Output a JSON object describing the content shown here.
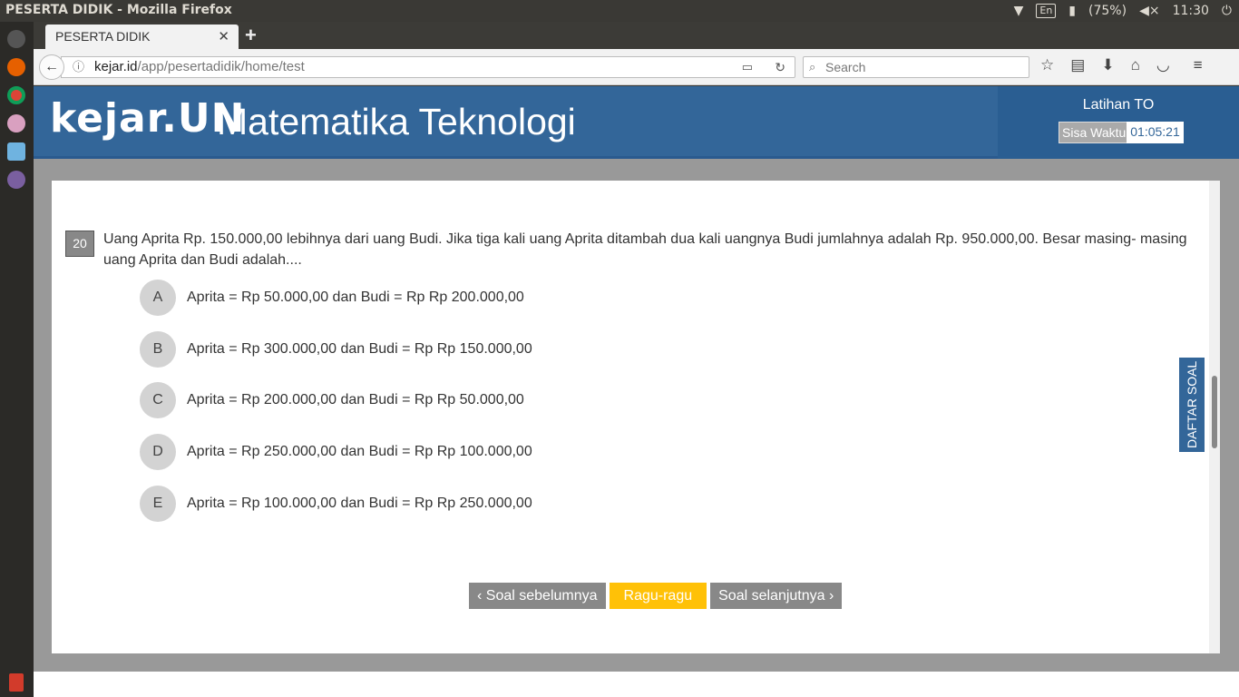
{
  "os": {
    "window_title": "PESERTA DIDIK - Mozilla Firefox",
    "keyboard": "En",
    "battery": "(75%)",
    "clock": "11:30"
  },
  "browser": {
    "tab_title": "PESERTA DIDIK",
    "url_domain": "kejar.id",
    "url_path": "/app/pesertadidik/home/test",
    "search_placeholder": "Search"
  },
  "header": {
    "logo": "kejar.UN",
    "subject": "Matematika Teknologi",
    "exam_title": "Latihan TO",
    "timer_label": "Sisa Waktu",
    "timer_value": "01:05:21"
  },
  "question": {
    "number": "20",
    "text": "Uang Aprita Rp. 150.000,00 lebihnya dari uang Budi. Jika tiga kali uang Aprita ditambah dua kali uangnya Budi jumlahnya adalah Rp. 950.000,00. Besar masing- masing uang Aprita dan Budi adalah....",
    "options": [
      {
        "letter": "A",
        "text": "Aprita = Rp 50.000,00 dan Budi = Rp Rp 200.000,00"
      },
      {
        "letter": "B",
        "text": "Aprita = Rp 300.000,00 dan Budi = Rp Rp 150.000,00"
      },
      {
        "letter": "C",
        "text": "Aprita = Rp 200.000,00 dan Budi = Rp Rp 50.000,00"
      },
      {
        "letter": "D",
        "text": "Aprita = Rp 250.000,00 dan Budi = Rp Rp 100.000,00"
      },
      {
        "letter": "E",
        "text": "Aprita = Rp 100.000,00 dan Budi = Rp Rp 250.000,00"
      }
    ]
  },
  "buttons": {
    "prev": "‹ Soal sebelumnya",
    "doubt": "Ragu-ragu",
    "next": "Soal selanjutnya ›"
  },
  "side_tab": "DAFTAR SOAL"
}
